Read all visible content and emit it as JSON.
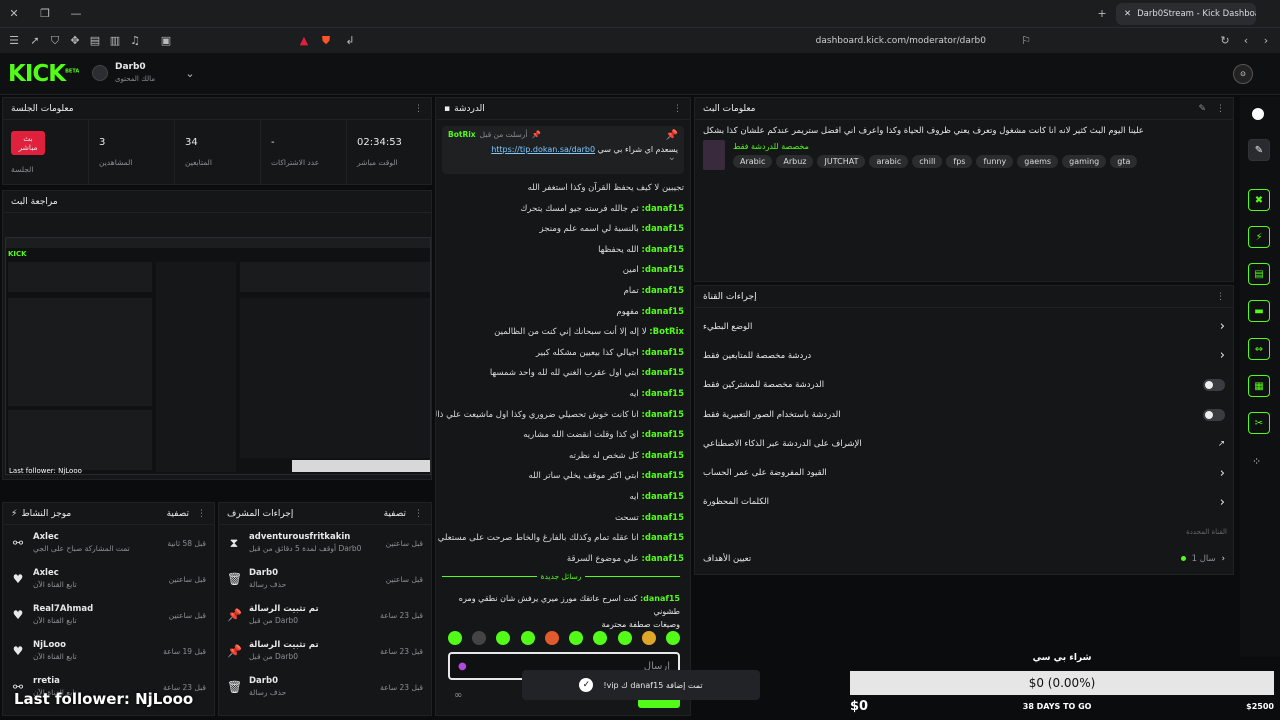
{
  "browser": {
    "tab_title": "Darb0Stream - Kick Dashboard",
    "url": "dashboard.kick.com/moderator/darb0"
  },
  "header": {
    "logo": "KICK",
    "logo_beta": "BETA",
    "channel_name": "Darb0",
    "channel_role": "مالك المحتوى"
  },
  "session": {
    "title": "معلومات الجلسة",
    "live_badge": "بث مباشر",
    "session_label": "الجلسة",
    "viewers_value": "3",
    "viewers_label": "المشاهدين",
    "followers_value": "34",
    "followers_label": "المتابعين",
    "subs_value": "-",
    "subs_label": "عدد الاشتراكات",
    "time_value": "02:34:53",
    "time_label": "الوقت مباشر"
  },
  "preview": {
    "title": "مراجعة البث",
    "overlay_text": "Last follower: NjLooo"
  },
  "activity": {
    "title": "موجز النشاط",
    "filter": "تصفية",
    "items": [
      {
        "user": "Axlec",
        "desc": "تمت المشاركة صباح على الجي",
        "time": "قبل 58 ثانية",
        "icon": "share-icon"
      },
      {
        "user": "Axlec",
        "desc": "تابع القناة الآن",
        "time": "قبل ساعتين",
        "icon": "heart-icon"
      },
      {
        "user": "Real7Ahmad",
        "desc": "تابع القناة الآن",
        "time": "قبل ساعتين",
        "icon": "heart-icon"
      },
      {
        "user": "NjLooo",
        "desc": "تابع القناة الآن",
        "time": "قبل 19 ساعة",
        "icon": "heart-icon"
      },
      {
        "user": "rretia",
        "desc": "تابع القناة الآن",
        "time": "قبل 23 ساعة",
        "icon": "share-icon"
      }
    ]
  },
  "modactions": {
    "title": "إجراءات المشرف",
    "filter": "تصفية",
    "items": [
      {
        "user": "adventurousfritkakin",
        "desc": "أوقف لمدة 5 دقائق من قبل Darb0",
        "time": "قبل ساعتين",
        "icon": "hourglass-icon"
      },
      {
        "user": "Darb0",
        "desc": "حذف رسالة",
        "time": "قبل ساعتين",
        "icon": "trash-icon"
      },
      {
        "user": "تم تثبيت الرسالة",
        "desc": "من قبل Darb0",
        "time": "قبل 23 ساعة",
        "icon": "pin-icon"
      },
      {
        "user": "تم تثبيت الرسالة",
        "desc": "من قبل Darb0",
        "time": "قبل 23 ساعة",
        "icon": "pin-icon"
      },
      {
        "user": "Darb0",
        "desc": "حذف رسالة",
        "time": "قبل 23 ساعة",
        "icon": "trash-icon"
      }
    ]
  },
  "chat": {
    "title": "الدردشة",
    "pinned_label": "أرسلت من قبل",
    "pinned_user": "BotRix",
    "pinned_text": "يسعدم اي شراء بي سي",
    "pinned_link": "https://tip.dokan.sa/darb0",
    "messages": [
      {
        "user": "",
        "text": "تجيبين لا كيف يحفظ القرآن وكذا استغفر الله"
      },
      {
        "user": "danaf15:",
        "text": "ثم جالله فرسته جيو امسك يتحرك"
      },
      {
        "user": "danaf15:",
        "text": "بالنسبة لي اسمه علم ومنجز"
      },
      {
        "user": "danaf15:",
        "text": "الله يحفظها"
      },
      {
        "user": "danaf15:",
        "text": "امين"
      },
      {
        "user": "danaf15:",
        "text": "تمام"
      },
      {
        "user": "danaf15:",
        "text": "مفهوم"
      },
      {
        "user": "BotRix:",
        "text": "لا إله إلا أنت سبحانك إني كنت من الظالمين"
      },
      {
        "user": "danaf15:",
        "text": "اجيالي كذا بيعيين مشكله كبير"
      },
      {
        "user": "danaf15:",
        "text": "ابتي اول عقرب الغني لله لله واحد شمسها"
      },
      {
        "user": "danaf15:",
        "text": "ايه"
      },
      {
        "user": "danaf15:",
        "text": "انا كانت خوش تحصيلي ضروري وكذا اول ماشيعت علي ذالك"
      },
      {
        "user": "danaf15:",
        "text": "اي كذا وقلت انقضت الله مشاريه"
      },
      {
        "user": "danaf15:",
        "text": "كل شخص له نظرته"
      },
      {
        "user": "danaf15:",
        "text": "ابتي اكثر موقف يخلي ساتر الله"
      },
      {
        "user": "danaf15:",
        "text": "ايه"
      },
      {
        "user": "danaf15:",
        "text": "تسحت"
      },
      {
        "user": "danaf15:",
        "text": "انا عقله تمام وكذلك بالفارغ والخاط صرحت على مستعلي"
      },
      {
        "user": "danaf15:",
        "text": "علي موضوع السرقة"
      }
    ],
    "new_messages": "رسائل جديدة",
    "last_message": "كنت اسرح عاتقك مورز ميري يرفش شان نطقي ومره طشوني",
    "last_message_2": "وصيغات صطفة محترمة",
    "input_placeholder": "إرسال"
  },
  "toast": {
    "text": "تمت إضافة danaf15 ك vip!"
  },
  "stream_info": {
    "title": "معلومات البث",
    "stream_title": "علينا اليوم البث كثير لانه انا كانت مشغول وتعرف يعني ظروف الحياة وكذا واعرف اني افضل ستريمر عندكم علشان كذا بشكل",
    "category": "مخصصة للدردشة فقط",
    "tags": [
      "Arabic",
      "Arbuz",
      "JUTCHAT",
      "arabic",
      "chill",
      "fps",
      "funny",
      "gaems",
      "gaming",
      "gta"
    ]
  },
  "channel_actions": {
    "title": "إجراءات القناة",
    "items": [
      {
        "label": "الوضع البطيء",
        "control": "chevron"
      },
      {
        "label": "دردشة مخصصة للمتابعين فقط",
        "control": "chevron"
      },
      {
        "label": "الدردشة مخصصة للمشتركين فقط",
        "control": "toggle"
      },
      {
        "label": "الدردشة باستخدام الصور التعبيرية فقط",
        "control": "toggle"
      },
      {
        "label": "الإشراف على الدردشة عبر الذكاء الاصطناعي",
        "control": "external"
      },
      {
        "label": "القيود المفروضة على عمر الحساب",
        "control": "chevron"
      },
      {
        "label": "الكلمات المحظورة",
        "control": "chevron"
      }
    ],
    "goal_section": "القناة المحددة",
    "goal_label": "تعيين الأهداف",
    "goal_value": "1 سال"
  },
  "goal_widget": {
    "title": "شراء بي سي",
    "amount": "$0 (0.00%)",
    "start": "$0",
    "days": "38 DAYS TO GO",
    "target": "$2500",
    "progress": 0
  },
  "colors": {
    "accent": "#53fc18",
    "live": "#e0213e"
  }
}
